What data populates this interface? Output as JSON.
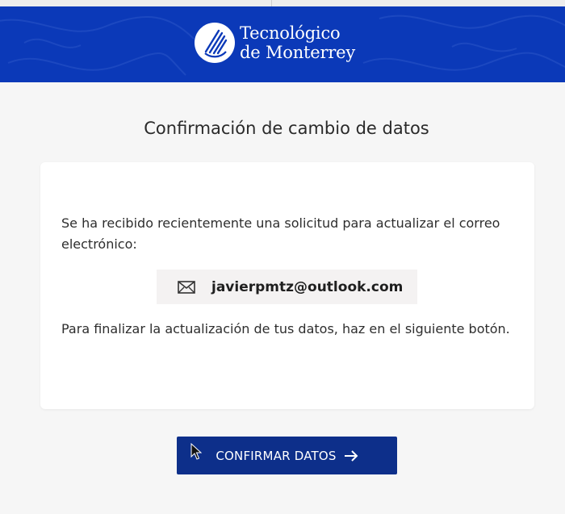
{
  "header": {
    "logo_line1": "Tecnológico",
    "logo_line2": "de Monterrey",
    "background_color": "#0b39b8"
  },
  "page": {
    "title": "Confirmación de cambio de datos"
  },
  "card": {
    "paragraph1": "Se ha recibido recientemente una solicitud para actualizar el correo electrónico:",
    "email": "javierpmtz@outlook.com",
    "email_icon": "envelope-icon",
    "paragraph2": "Para finalizar la actualización de tus datos, haz en el siguiente botón."
  },
  "actions": {
    "confirm_label": "CONFIRMAR DATOS",
    "confirm_icon": "arrow-right-icon",
    "button_color": "#0d2f8a"
  }
}
